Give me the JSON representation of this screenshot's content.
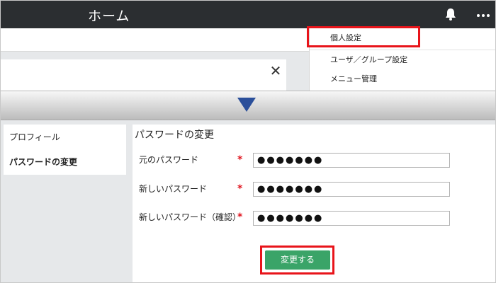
{
  "header": {
    "title": "ホーム"
  },
  "menu": {
    "items": [
      "個人設定",
      "ユーザ／グループ設定",
      "メニュー管理"
    ]
  },
  "sidebar": {
    "items": [
      "プロフィール",
      "パスワードの変更"
    ]
  },
  "form": {
    "title": "パスワードの変更",
    "required_mark": "*",
    "fields": [
      {
        "label": "元のパスワード",
        "value": "●●●●●●●"
      },
      {
        "label": "新しいパスワード",
        "value": "●●●●●●●"
      },
      {
        "label": "新しいパスワード（確認）",
        "value": "●●●●●●●"
      }
    ],
    "submit_label": "変更する"
  },
  "colors": {
    "topbar": "#2b2e31",
    "highlight": "#e8141a",
    "button": "#3aa468",
    "required": "#e0141e",
    "arrow": "#2b4f9a"
  },
  "icons": [
    "bell-icon",
    "more-icon",
    "close-icon",
    "down-arrow-icon"
  ]
}
